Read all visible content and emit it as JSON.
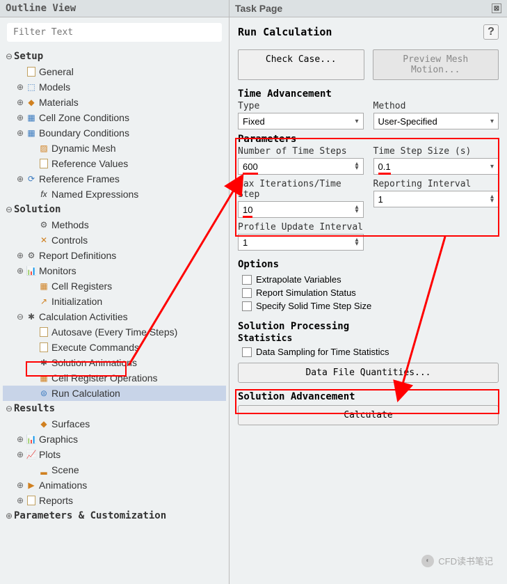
{
  "outline": {
    "header": "Outline View",
    "filter_placeholder": "Filter Text",
    "nodes": {
      "setup": "Setup",
      "general": "General",
      "models": "Models",
      "materials": "Materials",
      "cellzone": "Cell Zone Conditions",
      "boundary": "Boundary Conditions",
      "dynmesh": "Dynamic Mesh",
      "refvals": "Reference Values",
      "refframes": "Reference Frames",
      "namedexpr": "Named Expressions",
      "solution": "Solution",
      "methods": "Methods",
      "controls": "Controls",
      "reportdefs": "Report Definitions",
      "monitors": "Monitors",
      "cellreg": "Cell Registers",
      "init": "Initialization",
      "calcact": "Calculation Activities",
      "autosave": "Autosave (Every Time Steps)",
      "execcmd": "Execute Commands",
      "solanim": "Solution Animations",
      "cellregop": "Cell Register Operations",
      "runcalc": "Run Calculation",
      "results": "Results",
      "surfaces": "Surfaces",
      "graphics": "Graphics",
      "plots": "Plots",
      "scene": "Scene",
      "animations": "Animations",
      "reports": "Reports",
      "params": "Parameters & Customization"
    }
  },
  "task": {
    "header": "Task Page",
    "title": "Run Calculation",
    "check_case": "Check Case...",
    "preview_mesh": "Preview Mesh Motion...",
    "time_adv": "Time Advancement",
    "type_lbl": "Type",
    "type_val": "Fixed",
    "method_lbl": "Method",
    "method_val": "User-Specified",
    "params_lbl": "Parameters",
    "nsteps_lbl": "Number of Time Steps",
    "nsteps_val": "600",
    "tss_lbl": "Time Step Size (s)",
    "tss_val": "0.1",
    "maxit_lbl": "Max Iterations/Time Step",
    "maxit_val": "10",
    "repint_lbl": "Reporting Interval",
    "repint_val": "1",
    "pui_lbl": "Profile Update Interval",
    "pui_val": "1",
    "options_lbl": "Options",
    "opt1": "Extrapolate Variables",
    "opt2": "Report Simulation Status",
    "opt3": "Specify Solid Time Step Size",
    "solproc": "Solution Processing",
    "stats": "Statistics",
    "stats_opt": "Data Sampling for Time Statistics",
    "dfq_btn": "Data File Quantities...",
    "soladv": "Solution Advancement",
    "calc_btn": "Calculate"
  },
  "watermark": "CFD读书笔记"
}
